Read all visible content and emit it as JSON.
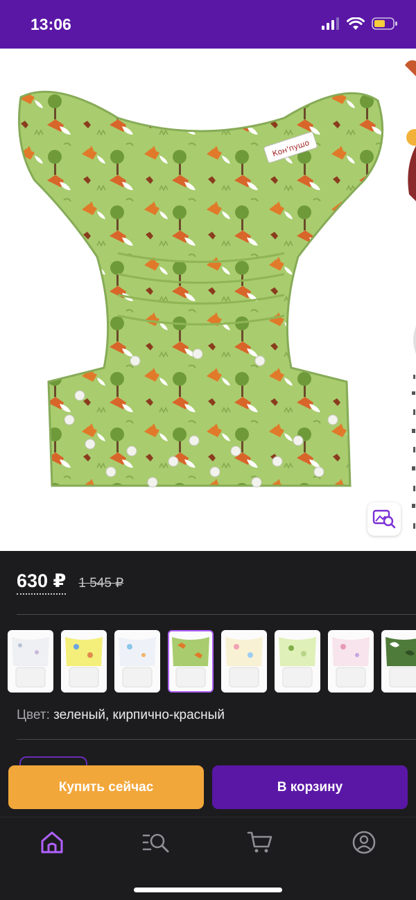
{
  "status_bar": {
    "time": "13:06"
  },
  "gallery": {
    "brand_tag": "Кон'пушо",
    "icons": [
      "back-chevron-icon",
      "heart-icon",
      "share-icon",
      "visual-search-icon"
    ]
  },
  "price": {
    "current": "630 ₽",
    "old": "1 545 ₽"
  },
  "variants": [
    {
      "print": "white",
      "selected": false
    },
    {
      "print": "yellow",
      "selected": false
    },
    {
      "print": "light-blue",
      "selected": false
    },
    {
      "print": "green-foxes",
      "selected": true
    },
    {
      "print": "cream",
      "selected": false
    },
    {
      "print": "light-green",
      "selected": false
    },
    {
      "print": "pink",
      "selected": false
    },
    {
      "print": "green-camo",
      "selected": false
    }
  ],
  "color": {
    "label": "Цвет:",
    "value": "зеленый, кирпично-красный"
  },
  "actions": {
    "buy_now": "Купить сейчас",
    "add_to_cart": "В корзину"
  },
  "tabbar": [
    "home-icon",
    "catalog-search-icon",
    "cart-icon",
    "profile-icon"
  ],
  "colors": {
    "brand_purple": "#5a17a6",
    "buy_orange": "#f2a73b",
    "tab_active": "#b061ff",
    "tab_inactive": "#8e8e93"
  }
}
